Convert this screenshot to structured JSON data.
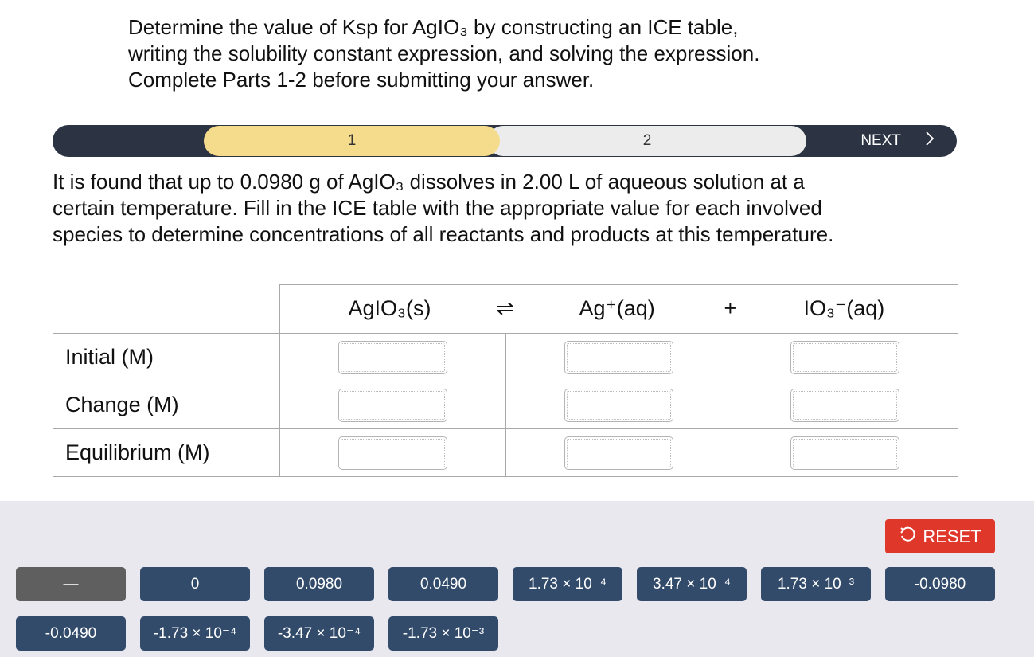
{
  "intro_lines": [
    "Determine the value of Ksp for AgIO₃ by constructing an ICE table,",
    "writing the solubility constant expression, and solving the expression.",
    "Complete Parts 1-2 before submitting your answer."
  ],
  "stepper": {
    "steps": [
      "1",
      "2"
    ],
    "active_step": "1",
    "next_label": "NEXT",
    "next_icon": "chevron-right-icon"
  },
  "question_lines": [
    "It is found that up to 0.0980 g of AgIO₃ dissolves in 2.00 L of aqueous solution at a",
    "certain temperature. Fill in the ICE table with the appropriate value for each involved",
    "species to determine concentrations of all reactants and products at this temperature."
  ],
  "ice_table": {
    "species": [
      "AgIO₃(s)",
      "Ag⁺(aq)",
      "IO₃⁻(aq)"
    ],
    "operators": [
      "⇌",
      "+"
    ],
    "rows": [
      "Initial (M)",
      "Change (M)",
      "Equilibrium (M)"
    ]
  },
  "reset": {
    "label": "RESET",
    "icon": "undo-icon",
    "color": "#e0372b"
  },
  "tiles": [
    "—",
    "0",
    "0.0980",
    "0.0490",
    "1.73 × 10⁻⁴",
    "3.47 × 10⁻⁴",
    "1.73 × 10⁻³",
    "-0.0980",
    "-0.0490",
    "-1.73 × 10⁻⁴",
    "-3.47 × 10⁻⁴",
    "-1.73 × 10⁻³"
  ],
  "colors": {
    "stepper_bg": "#2c3443",
    "active_step": "#f5dc8c",
    "inactive_step": "#ececec",
    "tile": "#324b6b",
    "tile_dash": "#5f5f5f",
    "tray": "#e8e8ee"
  }
}
